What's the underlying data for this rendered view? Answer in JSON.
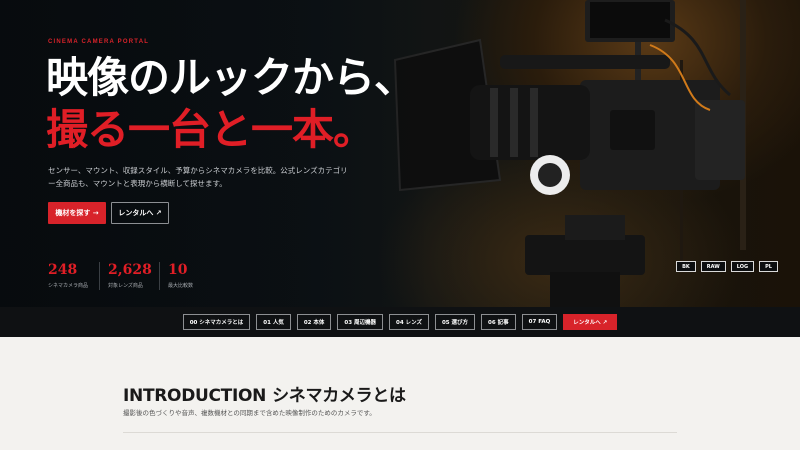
{
  "hero": {
    "eyebrow": "CINEMA CAMERA PORTAL",
    "headline_line1": "映像のルックから、",
    "headline_line2": "撮る一台と一本。",
    "lede": "センサー、マウント、収録スタイル、予算からシネマカメラを比較。公式レンズカテゴリー全商品も、マウントと表現から横断して探せます。",
    "primary_button": "機材を探す →",
    "secondary_button": "レンタルへ ↗",
    "stats": [
      {
        "value": "248",
        "label": "シネマカメラ商品"
      },
      {
        "value": "2,628",
        "label": "対象レンズ商品"
      },
      {
        "value": "10",
        "label": "最大比較数"
      }
    ],
    "badges": [
      "BK",
      "RAW",
      "LOG",
      "PL"
    ]
  },
  "nav": {
    "items": [
      "00 シネマカメラとは",
      "01 人気",
      "02 本体",
      "03 周辺機器",
      "04 レンズ",
      "05 選び方",
      "06 記事",
      "07 FAQ"
    ],
    "cta": "レンタルへ ↗"
  },
  "intro": {
    "title_en": "INTRODUCTION",
    "title_ja": "シネマカメラとは",
    "body": "撮影後の色づくりや音声、複数機材との同期まで含めた映像制作のためのカメラです。"
  },
  "colors": {
    "accent": "#d8232a",
    "dark": "#0f1113"
  }
}
